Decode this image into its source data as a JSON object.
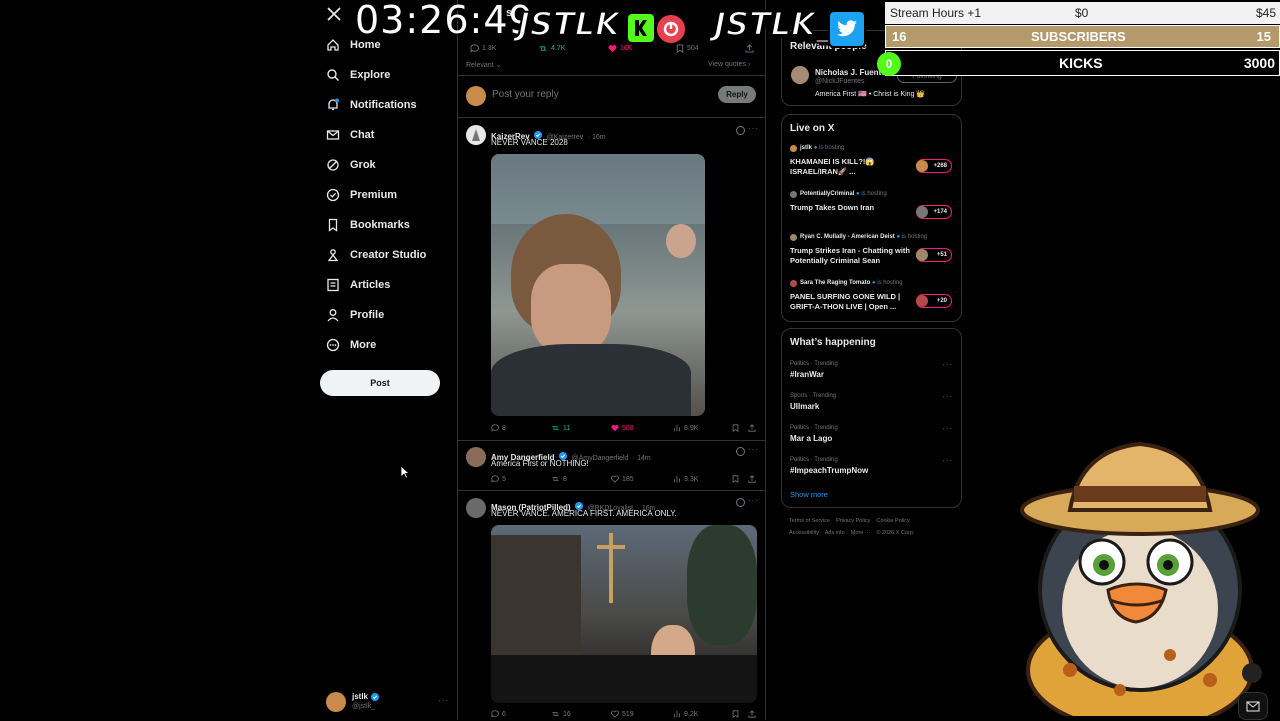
{
  "nav": {
    "items": [
      {
        "label": "Home",
        "icon": "home-icon"
      },
      {
        "label": "Explore",
        "icon": "search-icon"
      },
      {
        "label": "Notifications",
        "icon": "bell-icon"
      },
      {
        "label": "Chat",
        "icon": "mail-icon"
      },
      {
        "label": "Grok",
        "icon": "grok-icon"
      },
      {
        "label": "Premium",
        "icon": "premium-icon"
      },
      {
        "label": "Bookmarks",
        "icon": "bookmark-icon"
      },
      {
        "label": "Creator Studio",
        "icon": "creator-icon"
      },
      {
        "label": "Articles",
        "icon": "articles-icon"
      },
      {
        "label": "Profile",
        "icon": "profile-icon"
      },
      {
        "label": "More",
        "icon": "more-icon"
      }
    ],
    "post_label": "Post",
    "account": {
      "name": "jstlk",
      "handle": "@jstlk_"
    }
  },
  "main": {
    "top_stats": {
      "replies": "1.3K",
      "reposts": "4.7K",
      "likes": "16K",
      "bookmarks": "504"
    },
    "sort_label": "Relevant",
    "view_quotes": "View quotes",
    "reply_placeholder": "Post your reply",
    "reply_button": "Reply",
    "tweets": [
      {
        "name": "KaizerRev",
        "handle": "@Kaizerrev",
        "time": "16m",
        "text": "NEVER VANCE 2028",
        "replies": "8",
        "reposts": "11",
        "likes": "508",
        "views": "8.9K"
      },
      {
        "name": "Amy Dangerfield",
        "handle": "@AmyDangerfield",
        "time": "14m",
        "text": "America First or NOTHING!",
        "replies": "5",
        "reposts": "8",
        "likes": "185",
        "views": "3.3K"
      },
      {
        "name": "Mason (PatriotPilled)",
        "handle": "@RKDLoyalist",
        "time": "16m",
        "text": "NEVER VANCE. AMERICA FIRST. AMERICA ONLY.",
        "replies": "6",
        "reposts": "16",
        "likes": "519",
        "views": "9.2K"
      }
    ]
  },
  "right": {
    "relevant_title": "Relevant people",
    "person": {
      "name": "Nicholas J. Fuentes",
      "handle": "@NickJFuentes",
      "follow_label": "Following",
      "bio": "America First 🇺🇸 • Christ is King 👑"
    },
    "live_title": "Live on X",
    "live": [
      {
        "host": "jstlk",
        "status": "is hosting",
        "title": "KHAMANEI IS KILL?!😱 ISRAEL/IRAN🚀 ...",
        "count": "+268"
      },
      {
        "host": "PotentiallyCriminal",
        "status": "is hosting",
        "title": "Trump Takes Down Iran",
        "count": "+174"
      },
      {
        "host": "Ryan C. Mullally - American Deist",
        "status": "is hosting",
        "title": "Trump Strikes Iran - Chatting with Potentially Criminal Sean",
        "count": "+51"
      },
      {
        "host": "Sara The Raging Tomato",
        "status": "is hosting",
        "title": "PANEL SURFING GONE WILD | GRIFT-A-THON LIVE | Open ...",
        "count": "+20"
      }
    ],
    "happening_title": "What’s happening",
    "trends": [
      {
        "category": "Politics · Trending",
        "name": "#IranWar"
      },
      {
        "category": "Sports · Trending",
        "name": "Ullmark"
      },
      {
        "category": "Politics · Trending",
        "name": "Mar a Lago"
      },
      {
        "category": "Politics · Trending",
        "name": "#ImpeachTrumpNow"
      }
    ],
    "show_more": "Show more",
    "footer_line1": "Terms of Service    Privacy Policy    Cookie Policy",
    "footer_line2": "Accessibility    Ads info    More ···    © 2026 X Corp."
  },
  "overlay": {
    "clock": "03:26:49",
    "logo1": "JSTLK",
    "logo2": "JSTLK_",
    "stream_hours": "Stream Hours +1",
    "stream_min": "$0",
    "stream_max": "$45",
    "subs_left": "16",
    "subs_label": "SUBSCRIBERS",
    "subs_right": "15",
    "kicks_count": "0",
    "kicks_label": "KICKS",
    "kicks_goal": "3000",
    "header_fragment": "st"
  },
  "colors": {
    "accent": "#1d9bf0",
    "like": "#f91880",
    "repost": "#00ba7c",
    "kick_green": "#53fc18",
    "subs_bar": "#b49a6a"
  }
}
